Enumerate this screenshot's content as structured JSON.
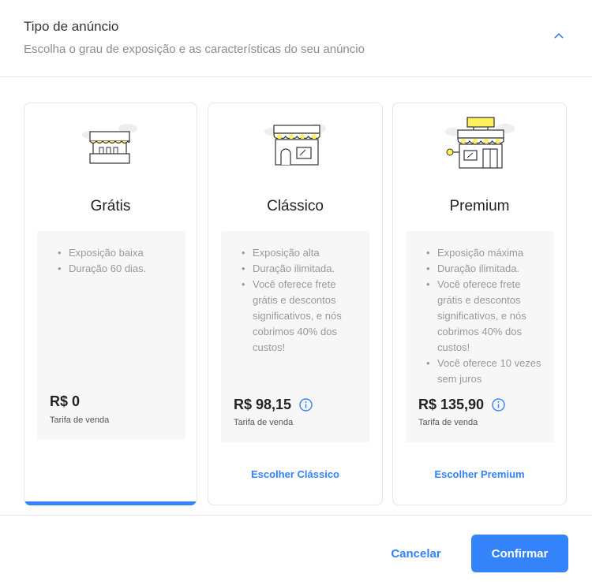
{
  "header": {
    "title": "Tipo de anúncio",
    "subtitle": "Escolha o grau de exposição e as características do seu anúncio"
  },
  "plans": [
    {
      "name": "Grátis",
      "features": [
        "Exposição baixa",
        "Duração 60 dias."
      ],
      "price": "R$ 0",
      "price_caption": "Tarifa de venda",
      "selected": true
    },
    {
      "name": "Clássico",
      "features": [
        "Exposição alta",
        "Duração ilimitada.",
        "Você oferece frete grátis e descontos significativos, e nós cobrimos 40% dos custos!"
      ],
      "price": "R$ 98,15",
      "price_caption": "Tarifa de venda",
      "choose_label": "Escolher Clássico",
      "selected": false
    },
    {
      "name": "Premium",
      "features": [
        "Exposição máxima",
        "Duração ilimitada.",
        "Você oferece frete grátis e descontos significativos, e nós cobrimos 40% dos custos!",
        "Você oferece 10 vezes sem juros"
      ],
      "price": "R$ 135,90",
      "price_caption": "Tarifa de venda",
      "choose_label": "Escolher Premium",
      "selected": false
    }
  ],
  "footer": {
    "cancel_label": "Cancelar",
    "confirm_label": "Confirmar"
  },
  "colors": {
    "accent": "#3483fa",
    "awning_yellow": "#fff159"
  }
}
